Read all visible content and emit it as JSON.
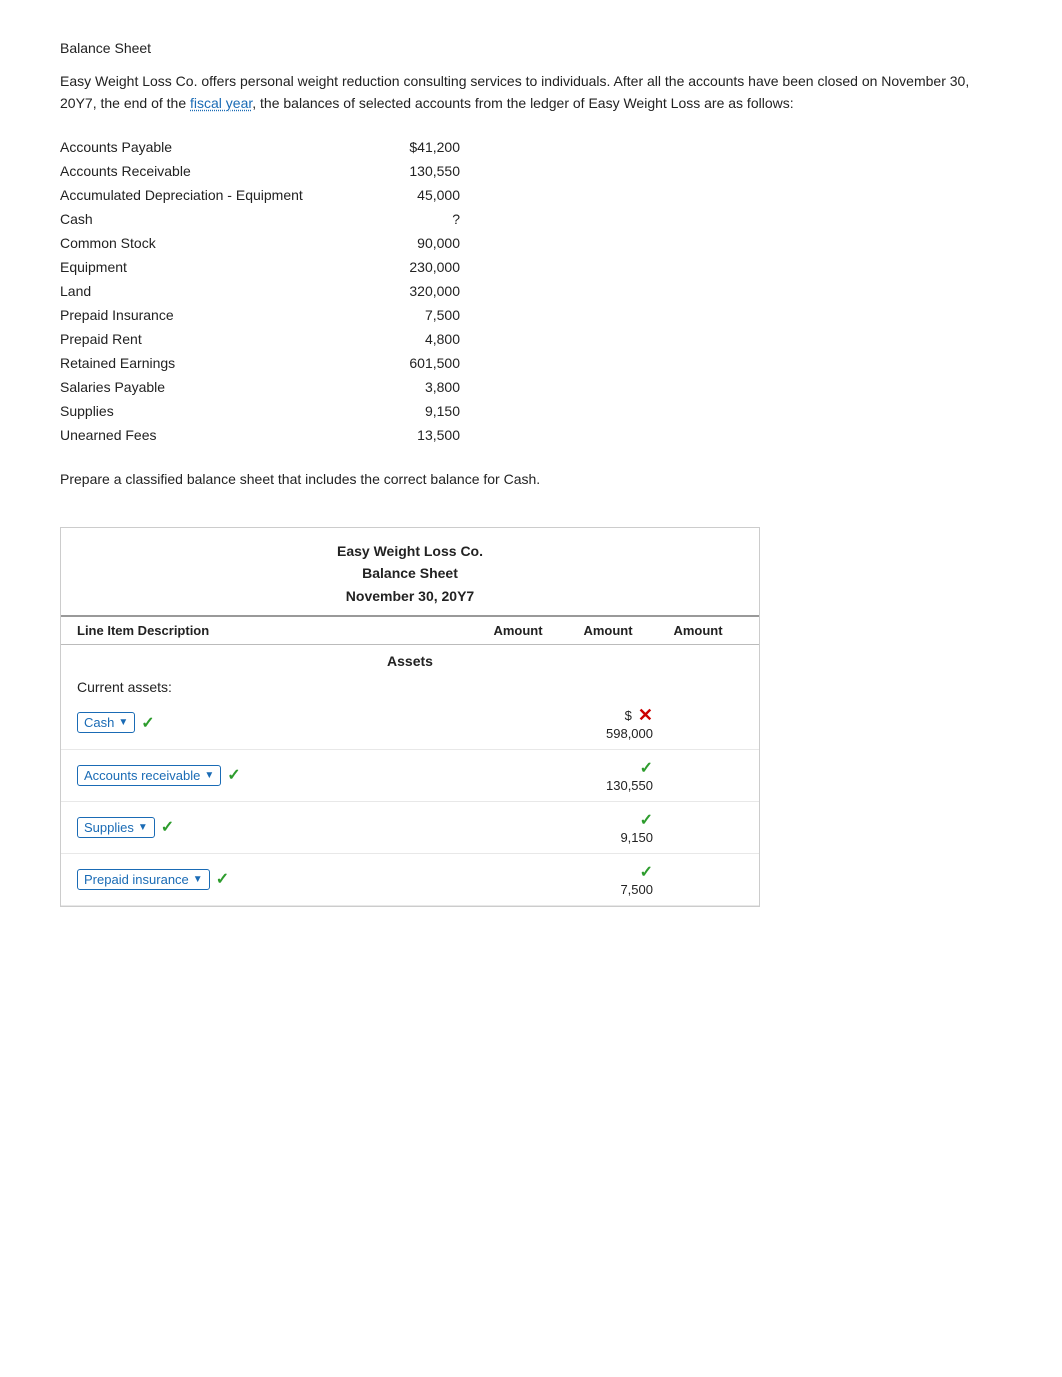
{
  "page": {
    "section_title": "Balance Sheet",
    "intro": {
      "text_before": "Easy Weight Loss Co. offers personal weight reduction consulting services to individuals. After all the accounts have been closed on November 30, 20Y7, the end of the ",
      "link_text": "fiscal year",
      "text_after": ", the balances of selected accounts from the ledger of Easy Weight Loss are as follows:"
    },
    "accounts": [
      {
        "name": "Accounts Payable",
        "value": "$41,200"
      },
      {
        "name": "Accounts Receivable",
        "value": "130,550"
      },
      {
        "name": "Accumulated Depreciation - Equipment",
        "value": "45,000"
      },
      {
        "name": "Cash",
        "value": "?"
      },
      {
        "name": "Common Stock",
        "value": "90,000"
      },
      {
        "name": "Equipment",
        "value": "230,000"
      },
      {
        "name": "Land",
        "value": "320,000"
      },
      {
        "name": "Prepaid Insurance",
        "value": "7,500"
      },
      {
        "name": "Prepaid Rent",
        "value": "4,800"
      },
      {
        "name": "Retained Earnings",
        "value": "601,500"
      },
      {
        "name": "Salaries Payable",
        "value": "3,800"
      },
      {
        "name": "Supplies",
        "value": "9,150"
      },
      {
        "name": "Unearned Fees",
        "value": "13,500"
      }
    ],
    "prepare_text": "Prepare a classified balance sheet that includes the correct balance for Cash.",
    "balance_sheet": {
      "company": "Easy Weight Loss Co.",
      "title": "Balance Sheet",
      "date": "November 30, 20Y7",
      "columns": [
        "Line Item Description",
        "Amount",
        "Amount",
        "Amount"
      ],
      "sections": [
        {
          "label": "Assets",
          "subsections": [
            {
              "label": "Current assets:",
              "rows": [
                {
                  "field_label": "Cash",
                  "field_check": true,
                  "dollar_sign": true,
                  "has_x": true,
                  "amount_col": 1,
                  "amount": "598,000"
                },
                {
                  "field_label": "Accounts receivable",
                  "field_check": true,
                  "dollar_sign": false,
                  "has_x": false,
                  "amount_col": 1,
                  "amount": "130,550"
                },
                {
                  "field_label": "Supplies",
                  "field_check": true,
                  "dollar_sign": false,
                  "has_x": false,
                  "amount_col": 1,
                  "amount": "9,150"
                },
                {
                  "field_label": "Prepaid insurance",
                  "field_check": true,
                  "dollar_sign": false,
                  "has_x": false,
                  "amount_col": 1,
                  "amount": "7,500"
                }
              ]
            }
          ]
        }
      ]
    }
  }
}
